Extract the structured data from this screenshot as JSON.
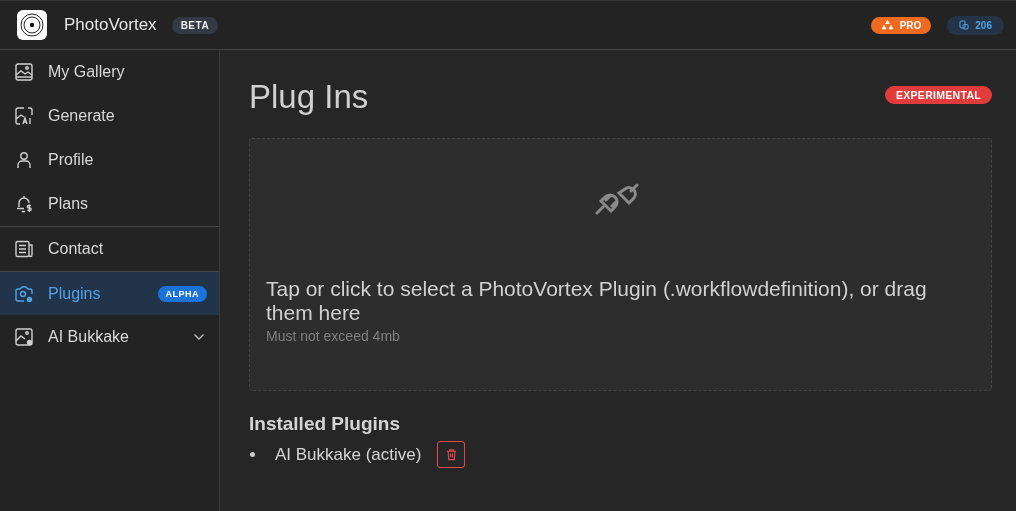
{
  "header": {
    "app_name": "PhotoVortex",
    "app_badge": "BETA",
    "plan_badge": "PRO",
    "credits": "206"
  },
  "sidebar": {
    "groups": [
      {
        "items": [
          {
            "label": "My Gallery",
            "kind": "gallery",
            "selected": false
          },
          {
            "label": "Generate",
            "kind": "generate",
            "selected": false
          },
          {
            "label": "Profile",
            "kind": "profile",
            "selected": false
          },
          {
            "label": "Plans",
            "kind": "plans",
            "selected": false
          }
        ]
      },
      {
        "items": [
          {
            "label": "Contact",
            "kind": "contact",
            "selected": false
          },
          {
            "label": "Plugins",
            "kind": "plugins",
            "selected": true,
            "badge": "ALPHA"
          },
          {
            "label": "AI Bukkake",
            "kind": "extension",
            "selected": false,
            "expandable": true
          }
        ]
      }
    ]
  },
  "page": {
    "title": "Plug Ins",
    "badge": "EXPERIMENTAL",
    "dropzone": {
      "prompt": "Tap or click to select a PhotoVortex Plugin (.workflowdefinition), or drag them here",
      "hint": "Must not exceed 4mb"
    },
    "installed": {
      "heading": "Installed Plugins",
      "items": [
        {
          "name": "AI Bukkake (active)"
        }
      ]
    }
  }
}
